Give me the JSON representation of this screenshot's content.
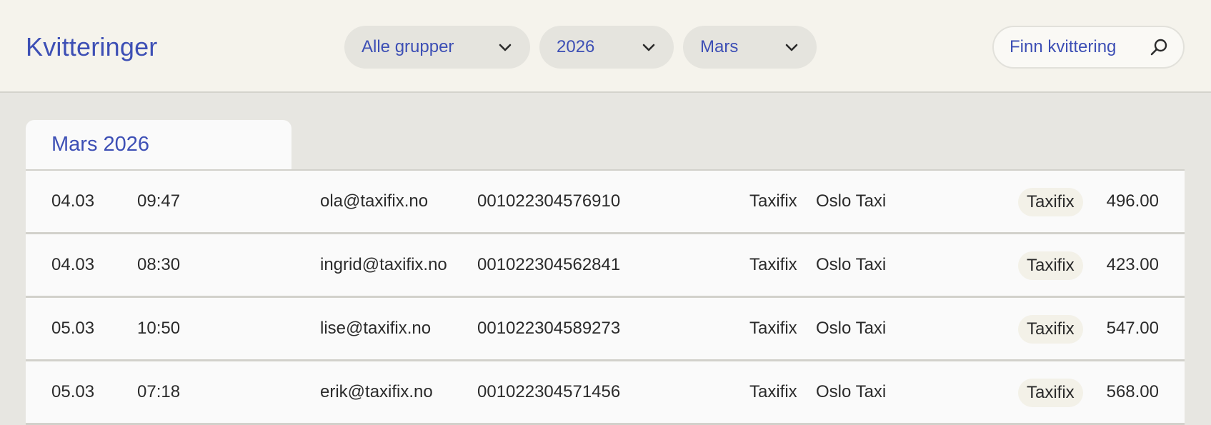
{
  "header": {
    "title": "Kvitteringer",
    "filters": {
      "group": "Alle grupper",
      "year": "2026",
      "month": "Mars"
    },
    "search": {
      "placeholder": "Finn kvittering",
      "icon": "search-icon"
    }
  },
  "section": {
    "title": "Mars 2026"
  },
  "receipts": [
    {
      "date": "04.03",
      "time": "09:47",
      "email": "ola@taxifix.no",
      "ref": "001022304576910",
      "company": "Taxifix",
      "operator": "Oslo Taxi",
      "tag": "Taxifix",
      "amount": "496.00"
    },
    {
      "date": "04.03",
      "time": "08:30",
      "email": "ingrid@taxifix.no",
      "ref": "001022304562841",
      "company": "Taxifix",
      "operator": "Oslo Taxi",
      "tag": "Taxifix",
      "amount": "423.00"
    },
    {
      "date": "05.03",
      "time": "10:50",
      "email": "lise@taxifix.no",
      "ref": "001022304589273",
      "company": "Taxifix",
      "operator": "Oslo Taxi",
      "tag": "Taxifix",
      "amount": "547.00"
    },
    {
      "date": "05.03",
      "time": "07:18",
      "email": "erik@taxifix.no",
      "ref": "001022304571456",
      "company": "Taxifix",
      "operator": "Oslo Taxi",
      "tag": "Taxifix",
      "amount": "568.00"
    }
  ],
  "colors": {
    "accent": "#3d4fb5",
    "header_bg": "#f5f3ec",
    "page_bg": "#e7e6e1",
    "row_bg": "#fafafa",
    "tag_bg": "#f3f1e8"
  }
}
